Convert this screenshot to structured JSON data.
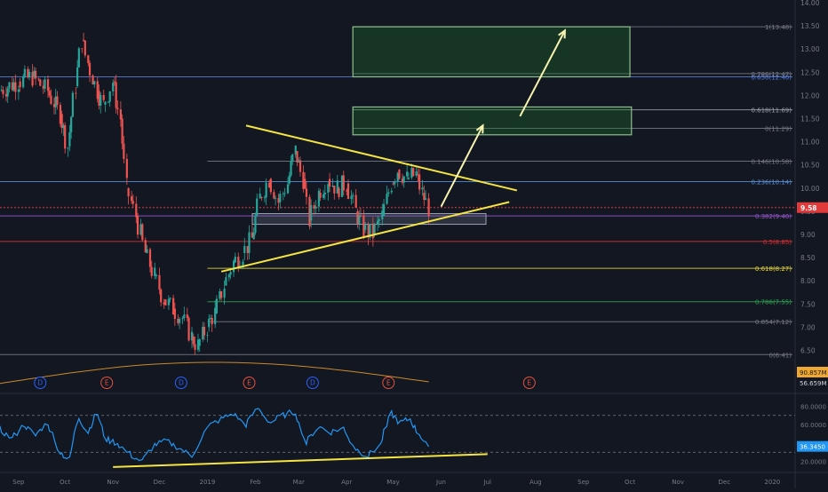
{
  "chart_data": {
    "type": "candlestick",
    "symbol_last_price": "9.58",
    "price_axis": {
      "min": 6.3,
      "max": 14.0,
      "tick_labels": [
        "14.00",
        "13.50",
        "13.00",
        "12.50",
        "12.00",
        "11.50",
        "11.00",
        "10.50",
        "10.00",
        "9.50",
        "9.00",
        "8.50",
        "8.00",
        "7.50",
        "7.00",
        "6.50"
      ],
      "tick_values": [
        14.0,
        13.5,
        13.0,
        12.5,
        12.0,
        11.5,
        11.0,
        10.5,
        10.0,
        9.5,
        9.0,
        8.5,
        8.0,
        7.5,
        7.0,
        6.5
      ]
    },
    "x_axis": {
      "tick_labels": [
        "Sep",
        "Oct",
        "Nov",
        "Dec",
        "2019",
        "Feb",
        "Mar",
        "Apr",
        "May",
        "Jun",
        "Jul",
        "Aug",
        "Sep",
        "Oct",
        "Nov",
        "Dec",
        "2020"
      ],
      "tick_dates": [
        "2018-09-01",
        "2018-10-01",
        "2018-11-01",
        "2018-12-01",
        "2019-01-01",
        "2019-02-01",
        "2019-03-01",
        "2019-04-01",
        "2019-05-01",
        "2019-06-01",
        "2019-07-01",
        "2019-08-01",
        "2019-09-01",
        "2019-10-01",
        "2019-11-01",
        "2019-12-01",
        "2020-01-01"
      ],
      "start": "2018-08-20",
      "end": "2020-01-10"
    },
    "price_series": [
      {
        "date": "2018-08-20",
        "close": 12.1
      },
      {
        "date": "2018-09-01",
        "close": 12.3
      },
      {
        "date": "2018-09-10",
        "close": 12.4
      },
      {
        "date": "2018-09-20",
        "close": 12.1
      },
      {
        "date": "2018-09-28",
        "close": 11.6
      },
      {
        "date": "2018-10-03",
        "close": 10.9
      },
      {
        "date": "2018-10-08",
        "close": 12.2
      },
      {
        "date": "2018-10-12",
        "close": 13.2
      },
      {
        "date": "2018-10-16",
        "close": 12.7
      },
      {
        "date": "2018-10-22",
        "close": 12.1
      },
      {
        "date": "2018-10-26",
        "close": 11.8
      },
      {
        "date": "2018-11-01",
        "close": 12.3
      },
      {
        "date": "2018-11-06",
        "close": 11.5
      },
      {
        "date": "2018-11-10",
        "close": 10.0
      },
      {
        "date": "2018-11-16",
        "close": 9.4
      },
      {
        "date": "2018-11-22",
        "close": 8.6
      },
      {
        "date": "2018-11-28",
        "close": 8.1
      },
      {
        "date": "2018-12-04",
        "close": 7.6
      },
      {
        "date": "2018-12-10",
        "close": 7.4
      },
      {
        "date": "2018-12-16",
        "close": 7.2
      },
      {
        "date": "2018-12-22",
        "close": 6.8
      },
      {
        "date": "2018-12-26",
        "close": 6.6
      },
      {
        "date": "2019-01-01",
        "close": 7.0
      },
      {
        "date": "2019-01-06",
        "close": 7.3
      },
      {
        "date": "2019-01-12",
        "close": 7.9
      },
      {
        "date": "2019-01-18",
        "close": 8.4
      },
      {
        "date": "2019-01-24",
        "close": 8.6
      },
      {
        "date": "2019-01-30",
        "close": 8.9
      },
      {
        "date": "2019-02-04",
        "close": 9.8
      },
      {
        "date": "2019-02-10",
        "close": 10.2
      },
      {
        "date": "2019-02-16",
        "close": 9.7
      },
      {
        "date": "2019-02-22",
        "close": 10.1
      },
      {
        "date": "2019-02-27",
        "close": 10.8
      },
      {
        "date": "2019-03-04",
        "close": 10.2
      },
      {
        "date": "2019-03-08",
        "close": 9.3
      },
      {
        "date": "2019-03-14",
        "close": 9.9
      },
      {
        "date": "2019-03-20",
        "close": 10.2
      },
      {
        "date": "2019-03-26",
        "close": 10.0
      },
      {
        "date": "2019-04-01",
        "close": 10.1
      },
      {
        "date": "2019-04-07",
        "close": 9.5
      },
      {
        "date": "2019-04-12",
        "close": 9.1
      },
      {
        "date": "2019-04-18",
        "close": 9.0
      },
      {
        "date": "2019-04-24",
        "close": 9.4
      },
      {
        "date": "2019-04-30",
        "close": 10.1
      },
      {
        "date": "2019-05-04",
        "close": 10.4
      },
      {
        "date": "2019-05-10",
        "close": 10.2
      },
      {
        "date": "2019-05-16",
        "close": 10.3
      },
      {
        "date": "2019-05-20",
        "close": 9.9
      },
      {
        "date": "2019-05-24",
        "close": 9.58
      }
    ],
    "fibonacci_levels": [
      {
        "label": "1(13.48)",
        "value": 13.48,
        "color": "#787b86"
      },
      {
        "label": "0.786(12.47)",
        "value": 12.47,
        "color": "#787b86"
      },
      {
        "label": "0.650(12.40)",
        "value": 12.4,
        "color": "#5b7fd6"
      },
      {
        "label": "0.618(11.69)",
        "value": 11.69,
        "color": "#9aa0aa"
      },
      {
        "label": "0(11.29)",
        "value": 11.29,
        "color": "#787b86"
      },
      {
        "label": "0.146(10.58)",
        "value": 10.58,
        "color": "#787b86"
      },
      {
        "label": "0.236(10.14)",
        "value": 10.14,
        "color": "#5b8fd6"
      },
      {
        "label": "0.382(9.40)",
        "value": 9.4,
        "color": "#9b59d0"
      },
      {
        "label": "0.5(8.85)",
        "value": 8.85,
        "color": "#e03030"
      },
      {
        "label": "0.618(8.27)",
        "value": 8.27,
        "color": "#e6d63a"
      },
      {
        "label": "0.786(7.55)",
        "value": 7.55,
        "color": "#2fa84f"
      },
      {
        "label": "0.854(7.12)",
        "value": 7.12,
        "color": "#787b86"
      },
      {
        "label": "0(6.41)",
        "value": 6.41,
        "color": "#787b86"
      }
    ],
    "volume_panel": {
      "label_a": "90.857M",
      "label_b": "56.659M",
      "color_a": "#f0a830",
      "color_b": "#131722"
    },
    "events": [
      {
        "date": "2018-09-15",
        "letter": "D",
        "type": "dividend"
      },
      {
        "date": "2018-10-28",
        "letter": "E",
        "type": "earnings"
      },
      {
        "date": "2018-12-15",
        "letter": "D",
        "type": "dividend"
      },
      {
        "date": "2019-01-28",
        "letter": "E",
        "type": "earnings"
      },
      {
        "date": "2019-03-10",
        "letter": "D",
        "type": "dividend"
      },
      {
        "date": "2019-04-28",
        "letter": "E",
        "type": "earnings"
      },
      {
        "date": "2019-07-28",
        "letter": "E",
        "type": "earnings"
      }
    ],
    "rsi": {
      "min": 10,
      "max": 90,
      "tick_labels": [
        "80.0000",
        "60.0000",
        "20.0000"
      ],
      "tick_values": [
        80,
        60,
        20
      ],
      "upper_band": 70,
      "lower_band": 30,
      "current_label": "36.3450",
      "series": [
        {
          "date": "2018-08-20",
          "value": 55
        },
        {
          "date": "2018-08-28",
          "value": 45
        },
        {
          "date": "2018-09-05",
          "value": 60
        },
        {
          "date": "2018-09-12",
          "value": 48
        },
        {
          "date": "2018-09-20",
          "value": 62
        },
        {
          "date": "2018-09-28",
          "value": 30
        },
        {
          "date": "2018-10-04",
          "value": 22
        },
        {
          "date": "2018-10-10",
          "value": 68
        },
        {
          "date": "2018-10-16",
          "value": 52
        },
        {
          "date": "2018-10-22",
          "value": 72
        },
        {
          "date": "2018-10-28",
          "value": 44
        },
        {
          "date": "2018-11-04",
          "value": 40
        },
        {
          "date": "2018-11-12",
          "value": 28
        },
        {
          "date": "2018-11-20",
          "value": 20
        },
        {
          "date": "2018-11-28",
          "value": 38
        },
        {
          "date": "2018-12-06",
          "value": 42
        },
        {
          "date": "2018-12-14",
          "value": 35
        },
        {
          "date": "2018-12-22",
          "value": 26
        },
        {
          "date": "2019-01-02",
          "value": 58
        },
        {
          "date": "2019-01-10",
          "value": 66
        },
        {
          "date": "2019-01-18",
          "value": 72
        },
        {
          "date": "2019-01-26",
          "value": 60
        },
        {
          "date": "2019-02-03",
          "value": 78
        },
        {
          "date": "2019-02-11",
          "value": 62
        },
        {
          "date": "2019-02-19",
          "value": 70
        },
        {
          "date": "2019-02-27",
          "value": 74
        },
        {
          "date": "2019-03-06",
          "value": 40
        },
        {
          "date": "2019-03-14",
          "value": 58
        },
        {
          "date": "2019-03-22",
          "value": 52
        },
        {
          "date": "2019-03-30",
          "value": 56
        },
        {
          "date": "2019-04-07",
          "value": 34
        },
        {
          "date": "2019-04-15",
          "value": 26
        },
        {
          "date": "2019-04-23",
          "value": 38
        },
        {
          "date": "2019-04-30",
          "value": 72
        },
        {
          "date": "2019-05-06",
          "value": 62
        },
        {
          "date": "2019-05-12",
          "value": 66
        },
        {
          "date": "2019-05-18",
          "value": 50
        },
        {
          "date": "2019-05-24",
          "value": 36
        }
      ]
    },
    "drawings": {
      "resistance_line": {
        "from": {
          "date": "2019-01-26",
          "price": 11.35
        },
        "to": {
          "date": "2019-07-20",
          "price": 9.95
        }
      },
      "support_line": {
        "from": {
          "date": "2019-01-10",
          "price": 8.2
        },
        "to": {
          "date": "2019-07-15",
          "price": 9.7
        }
      },
      "rsi_support_line": {
        "from": {
          "date": "2018-11-01",
          "value": 14
        },
        "to": {
          "date": "2019-07-01",
          "value": 28
        }
      },
      "arrow_1": {
        "from": {
          "date": "2019-06-01",
          "price": 9.6
        },
        "to": {
          "date": "2019-06-28",
          "price": 11.35
        }
      },
      "arrow_2": {
        "from": {
          "date": "2019-07-22",
          "price": 11.55
        },
        "to": {
          "date": "2019-08-20",
          "price": 13.4
        }
      },
      "target_box_1": {
        "from_date": "2019-04-05",
        "to_date": "2019-10-01",
        "top": 13.48,
        "bottom": 12.4
      },
      "target_box_2": {
        "from_date": "2019-04-05",
        "to_date": "2019-10-02",
        "top": 11.75,
        "bottom": 11.15
      },
      "consolidation_box": {
        "from_date": "2019-01-30",
        "to_date": "2019-06-30",
        "top": 9.45,
        "bottom": 9.22
      }
    }
  }
}
